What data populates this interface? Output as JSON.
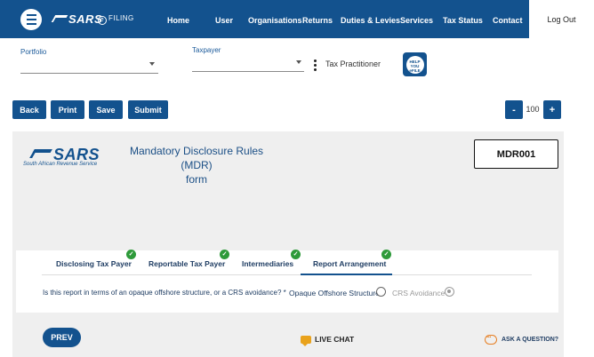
{
  "topnav": {
    "logo_text": "SARS",
    "efiling_text": "FILING",
    "efiling_e": "e",
    "items": [
      {
        "label": "Home"
      },
      {
        "label": "User"
      },
      {
        "label": "Organisations"
      },
      {
        "label": "Returns"
      },
      {
        "label": "Duties & Levies"
      },
      {
        "label": "Services"
      },
      {
        "label": "Tax Status"
      },
      {
        "label": "Contact"
      }
    ],
    "logout_label": "Log Out"
  },
  "selectors": {
    "portfolio_label": "Portfolio",
    "portfolio_value": "",
    "taxpayer_label": "Taxpayer",
    "taxpayer_value": "",
    "role_text": "Tax Practitioner",
    "help_badge_text": "HELP YOU eFILE"
  },
  "toolbar": {
    "back_label": "Back",
    "print_label": "Print",
    "save_label": "Save",
    "submit_label": "Submit",
    "zoom_out_label": "-",
    "zoom_value": "100",
    "zoom_in_label": "+"
  },
  "form": {
    "logo_text": "SARS",
    "logo_subtitle": "South African Revenue Service",
    "title_line1": "Mandatory Disclosure Rules (MDR)",
    "title_line2": "form",
    "code": "MDR001"
  },
  "tabs": [
    {
      "label": "Disclosing Tax Payer",
      "complete": true
    },
    {
      "label": "Reportable Tax Payer",
      "complete": true
    },
    {
      "label": "Intermediaries",
      "complete": true
    },
    {
      "label": "Report Arrangement",
      "complete": true,
      "active": true
    }
  ],
  "question": {
    "text": "Is this report in terms of an opaque offshore structure, or a CRS avoidance? *",
    "options": [
      {
        "label": "Opaque Offshore Structure",
        "selected": false
      },
      {
        "label": "CRS Avoidance",
        "selected": true
      }
    ]
  },
  "footer": {
    "prev_label": "PREV",
    "live_chat_label": "LIVE CHAT",
    "ask_label": "ASK A QUESTION?"
  },
  "colors": {
    "brand_blue": "#13528e",
    "check_green": "#2e9a3a",
    "chat_orange": "#e67e22",
    "panel_grey": "#efefef"
  }
}
